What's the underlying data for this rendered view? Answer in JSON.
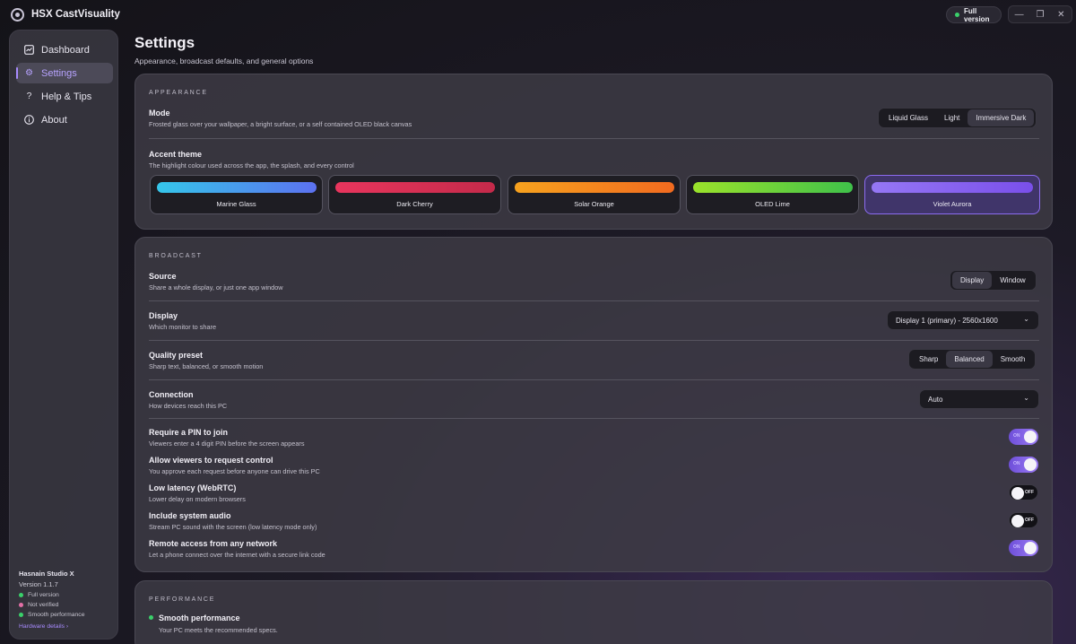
{
  "app": {
    "title": "HSX CastVisuality",
    "version_pill": "Full version"
  },
  "colors": {
    "accent": "#a88bff",
    "status_green": "#3ad06a",
    "status_pink": "#e26fa6",
    "marine_glass": [
      "#35c6ea",
      "#5c71f0"
    ],
    "dark_cherry": [
      "#e8355d",
      "#c42a4a"
    ],
    "solar_orange": [
      "#f7a21e",
      "#f16a1f"
    ],
    "oled_lime": [
      "#9be22b",
      "#3fc14a"
    ],
    "violet_aurora": [
      "#9577f5",
      "#7a4fea"
    ]
  },
  "sidebar": {
    "items": [
      {
        "label": "Dashboard",
        "icon": "dashboard-icon"
      },
      {
        "label": "Settings",
        "icon": "gear-icon",
        "active": true
      },
      {
        "label": "Help & Tips",
        "icon": "question-icon"
      },
      {
        "label": "About",
        "icon": "info-icon"
      }
    ],
    "footer": {
      "studio": "Hasnain Studio X",
      "version": "Version 1.1.7",
      "statuses": [
        {
          "label": "Full version",
          "color": "#3ad06a"
        },
        {
          "label": "Not verified",
          "color": "#e26fa6"
        },
        {
          "label": "Smooth performance",
          "color": "#3ad06a"
        }
      ],
      "link": "Hardware details ›"
    }
  },
  "page": {
    "title": "Settings",
    "subtitle": "Appearance, broadcast defaults, and general options"
  },
  "appearance": {
    "heading": "APPEARANCE",
    "mode": {
      "title": "Mode",
      "sub": "Frosted glass over your wallpaper, a bright surface, or a self contained OLED black canvas",
      "options": [
        "Liquid Glass",
        "Light",
        "Immersive Dark"
      ],
      "selected": "Immersive Dark"
    },
    "accent": {
      "title": "Accent theme",
      "sub": "The highlight colour used across the app, the splash, and every control",
      "themes": [
        "Marine Glass",
        "Dark Cherry",
        "Solar Orange",
        "OLED Lime",
        "Violet Aurora"
      ],
      "selected": "Violet Aurora"
    }
  },
  "broadcast": {
    "heading": "BROADCAST",
    "source": {
      "title": "Source",
      "sub": "Share a whole display, or just one app window",
      "options": [
        "Display",
        "Window"
      ],
      "selected": "Display"
    },
    "display": {
      "title": "Display",
      "sub": "Which monitor to share",
      "value": "Display 1 (primary) - 2560x1600"
    },
    "quality": {
      "title": "Quality preset",
      "sub": "Sharp text, balanced, or smooth motion",
      "options": [
        "Sharp",
        "Balanced",
        "Smooth"
      ],
      "selected": "Balanced"
    },
    "connection": {
      "title": "Connection",
      "sub": "How devices reach this PC",
      "value": "Auto"
    },
    "toggles": [
      {
        "title": "Require a PIN to join",
        "sub": "Viewers enter a 4 digit PIN before the screen appears",
        "on": true,
        "state": "ON"
      },
      {
        "title": "Allow viewers to request control",
        "sub": "You approve each request before anyone can drive this PC",
        "on": true,
        "state": "ON"
      },
      {
        "title": "Low latency (WebRTC)",
        "sub": "Lower delay on modern browsers",
        "on": false,
        "state": "OFF"
      },
      {
        "title": "Include system audio",
        "sub": "Stream PC sound with the screen (low latency mode only)",
        "on": false,
        "state": "OFF"
      },
      {
        "title": "Remote access from any network",
        "sub": "Let a phone connect over the internet with a secure link code",
        "on": true,
        "state": "ON"
      }
    ]
  },
  "performance": {
    "heading": "PERFORMANCE",
    "title": "Smooth performance",
    "sub": "Your PC meets the recommended specs."
  }
}
